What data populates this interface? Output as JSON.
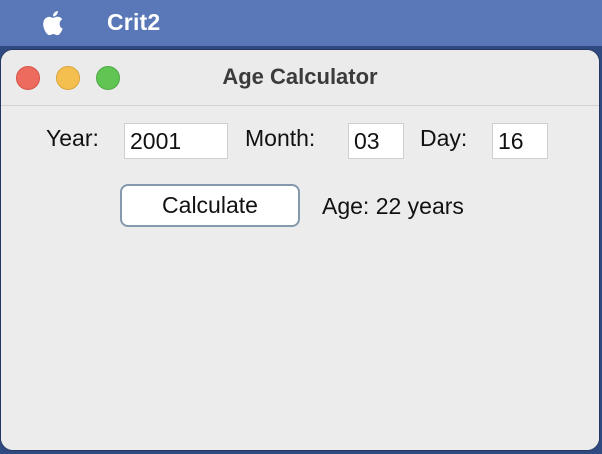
{
  "menubar": {
    "app_name": "Crit2",
    "apple_icon": "apple-logo-icon"
  },
  "window": {
    "title": "Age Calculator",
    "traffic_lights": {
      "close_color": "#ed6a5e",
      "minimize_color": "#f5bf4f",
      "zoom_color": "#61c554"
    }
  },
  "form": {
    "year_label": "Year:",
    "year_value": "2001",
    "month_label": "Month:",
    "month_value": "03",
    "day_label": "Day:",
    "day_value": "16",
    "calculate_label": "Calculate",
    "result_text": "Age: 22 years"
  }
}
